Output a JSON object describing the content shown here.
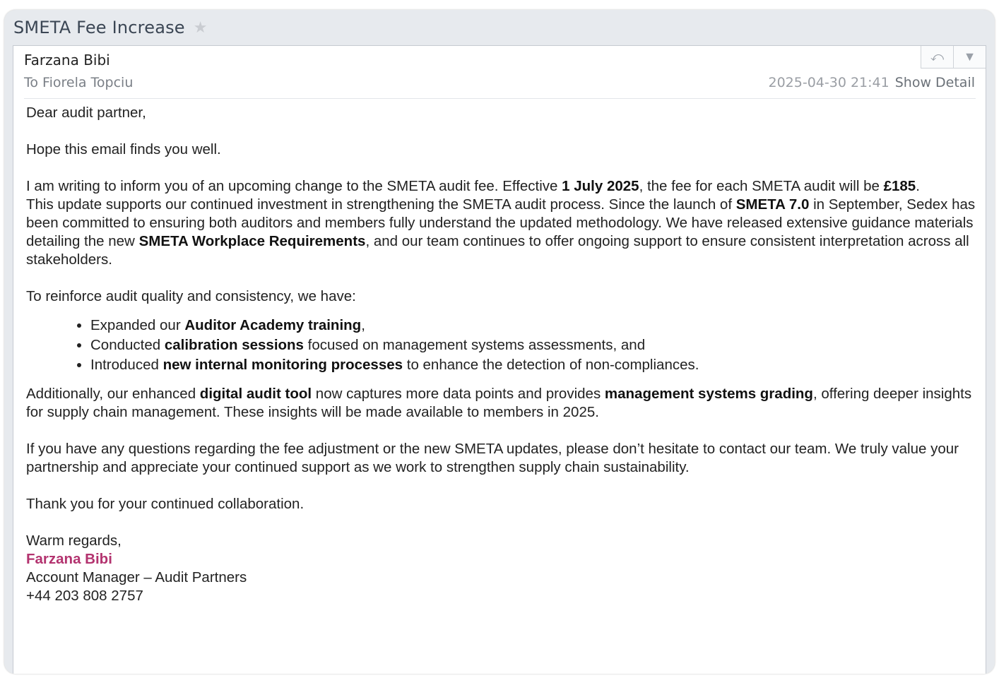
{
  "window": {
    "subject": "SMETA Fee Increase",
    "star_icon": "★"
  },
  "header": {
    "from": "Farzana Bibi",
    "to": "To Fiorela Topciu",
    "date": "2025-04-30 21:41",
    "show_detail": "Show Detail",
    "reply_icon": "⤺",
    "menu_icon": "▼"
  },
  "body": {
    "greeting": "Dear audit partner,",
    "intro": "Hope this email finds you well.",
    "p1_a": "I am writing to inform you of an upcoming change to the SMETA audit fee. Effective ",
    "p1_date": "1 July 2025",
    "p1_b": ", the fee for each SMETA audit will be ",
    "p1_fee": "£185",
    "p1_c": ".",
    "p2_a": "This update supports our continued investment in strengthening the SMETA audit process. Since the launch of ",
    "p2_b1": "SMETA 7.0",
    "p2_b": " in September, Sedex has been committed to ensuring both auditors and members fully understand the updated methodology. We have released extensive guidance materials detailing the new ",
    "p2_b2": "SMETA Workplace Requirements",
    "p2_c": ", and our team continues to offer ongoing support to ensure consistent interpretation across all stakeholders.",
    "p3": "To reinforce audit quality and consistency, we have:",
    "bullets": [
      {
        "pre": "Expanded our ",
        "bold": "Auditor Academy training",
        "post": ","
      },
      {
        "pre": "Conducted ",
        "bold": "calibration sessions",
        "post": " focused on management systems assessments, and"
      },
      {
        "pre": "Introduced ",
        "bold": "new internal monitoring processes",
        "post": " to enhance the detection of non-compliances."
      }
    ],
    "p4_a": "Additionally, our enhanced ",
    "p4_b1": "digital audit tool",
    "p4_b": " now captures more data points and provides ",
    "p4_b2": "management systems grading",
    "p4_c": ", offering deeper insights for supply chain management. These insights will be made available to members in 2025.",
    "p5": "If you have any questions regarding the fee adjustment or the new SMETA updates, please don’t hesitate to contact our team. We truly value your partnership and appreciate your continued support as we work to strengthen supply chain sustainability.",
    "p6": "Thank you for your continued collaboration.",
    "closing": "Warm regards,"
  },
  "signature": {
    "name": "Farzana Bibi",
    "title": "Account Manager – Audit Partners",
    "phone": "+44 203 808 2757",
    "name_color": "#b3336f"
  }
}
